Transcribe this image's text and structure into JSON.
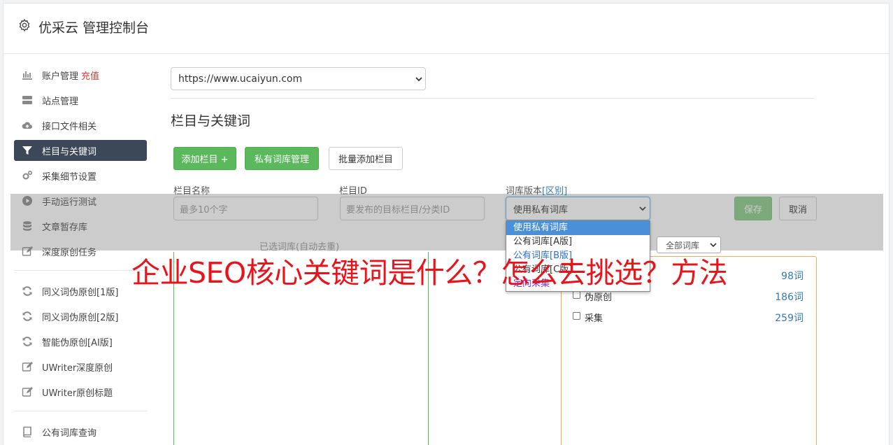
{
  "header": {
    "title": "优采云 管理控制台",
    "icon": "gear-icon"
  },
  "sidebar": {
    "items": [
      {
        "label": "账户管理",
        "badge": "充值",
        "icon": "bar-chart-icon"
      },
      {
        "label": "站点管理",
        "icon": "server-icon"
      },
      {
        "label": "接口文件相关",
        "icon": "cloud-upload-icon"
      },
      {
        "label": "栏目与关键词",
        "icon": "filter-icon",
        "active": true
      },
      {
        "label": "采集细节设置",
        "icon": "cogs-icon"
      },
      {
        "label": "手动运行测试",
        "icon": "play-circle-icon"
      },
      {
        "label": "文章暂存库",
        "icon": "database-icon"
      },
      {
        "label": "深度原创任务",
        "icon": "edit-icon"
      },
      {
        "label": "同义词伪原创[1版]",
        "icon": "refresh-icon"
      },
      {
        "label": "同义词伪原创[2版]",
        "icon": "refresh-icon"
      },
      {
        "label": "智能伪原创[AI版]",
        "icon": "refresh-icon"
      },
      {
        "label": "UWriter深度原创",
        "icon": "edit-icon"
      },
      {
        "label": "UWriter原创标题",
        "icon": "edit-icon"
      },
      {
        "label": "公有词库查询",
        "icon": "book-icon"
      }
    ]
  },
  "main": {
    "site_select": "https://www.ucaiyun.com",
    "section_title": "栏目与关键词",
    "buttons": {
      "add_column": "添加栏目 +",
      "private_lib": "私有词库管理",
      "batch_add": "批量添加栏目",
      "save": "保存",
      "cancel": "取消"
    },
    "form": {
      "name_label": "栏目名称",
      "name_placeholder": "最多10个字",
      "id_label": "栏目ID",
      "id_placeholder": "要发布的目标栏目/分类ID",
      "lib_label": "词库版本",
      "lib_link": "[区别]",
      "lib_value": "使用私有词库"
    },
    "dropdown_options": [
      "使用私有词库",
      "公有词库[A版]",
      "公有词库[B版]",
      "公有词库[C版]",
      "定向采集"
    ],
    "chosen_label": "已选词库(自动去重)",
    "filter_select": "全部词库",
    "libraries": [
      {
        "name": "",
        "count": "98词"
      },
      {
        "name": "伪原创",
        "count": "186词"
      },
      {
        "name": "采集",
        "count": "259词"
      }
    ]
  },
  "banner": "企业SEO核心关键词是什么？怎么去挑选？方法",
  "colors": {
    "active_nav": "#3c4858",
    "green": "#5cb85c",
    "banner_red": "#e8141c",
    "link": "#337ab7"
  }
}
